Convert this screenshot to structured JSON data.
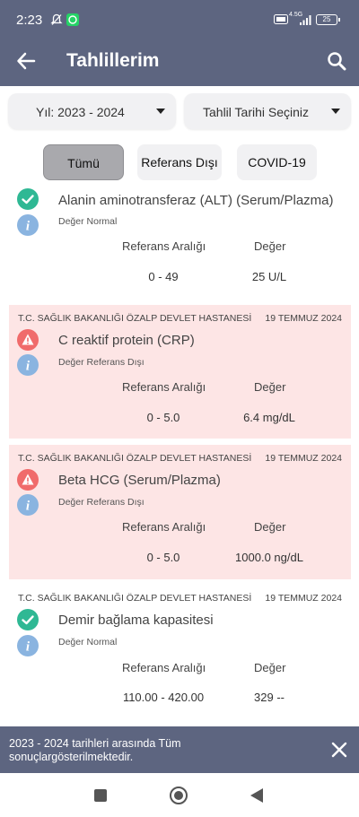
{
  "status_bar": {
    "time": "2:23",
    "battery": "25",
    "network": "4.5G"
  },
  "app_bar": {
    "title": "Tahlillerim"
  },
  "filters": {
    "year_label": "Yıl: 2023 - 2024",
    "date_label": "Tahlil Tarihi Seçiniz",
    "tabs": [
      "Tümü",
      "Referans Dışı",
      "COVID-19"
    ],
    "active_tab": "Tümü"
  },
  "table_headers": {
    "ref": "Referans Aralığı",
    "value": "Değer"
  },
  "results": [
    {
      "hospital": "",
      "date": "",
      "status": "normal",
      "name": "Alanin aminotransferaz (ALT) (Serum/Plazma)",
      "note": "Değer Normal",
      "ref": "0 - 49",
      "value": "25 U/L"
    },
    {
      "hospital": "T.C. SAĞLIK BAKANLIĞI ÖZALP DEVLET HASTANESİ",
      "date": "19 TEMMUZ 2024",
      "status": "out-of-range",
      "name": "C reaktif protein (CRP)",
      "note": "Değer Referans Dışı",
      "ref": "0 - 5.0",
      "value": "6.4 mg/dL"
    },
    {
      "hospital": "T.C. SAĞLIK BAKANLIĞI ÖZALP DEVLET HASTANESİ",
      "date": "19 TEMMUZ 2024",
      "status": "out-of-range",
      "name": "Beta HCG (Serum/Plazma)",
      "note": "Değer Referans Dışı",
      "ref": "0 - 5.0",
      "value": "1000.0 ng/dL"
    },
    {
      "hospital": "T.C. SAĞLIK BAKANLIĞI ÖZALP DEVLET HASTANESİ",
      "date": "19 TEMMUZ 2024",
      "status": "normal",
      "name": "Demir bağlama kapasitesi",
      "note": "Değer Normal",
      "ref": "110.00 - 420.00",
      "value": "329 --"
    }
  ],
  "snackbar": {
    "message": "2023 - 2024 tarihleri arasında Tüm sonuçlargösterilmektedir."
  },
  "colors": {
    "bar": "#5d6580",
    "alert_bg": "#fde5e5",
    "normal_check": "#2fb894",
    "warning": "#f06b6b",
    "info": "#8ab4e0"
  }
}
